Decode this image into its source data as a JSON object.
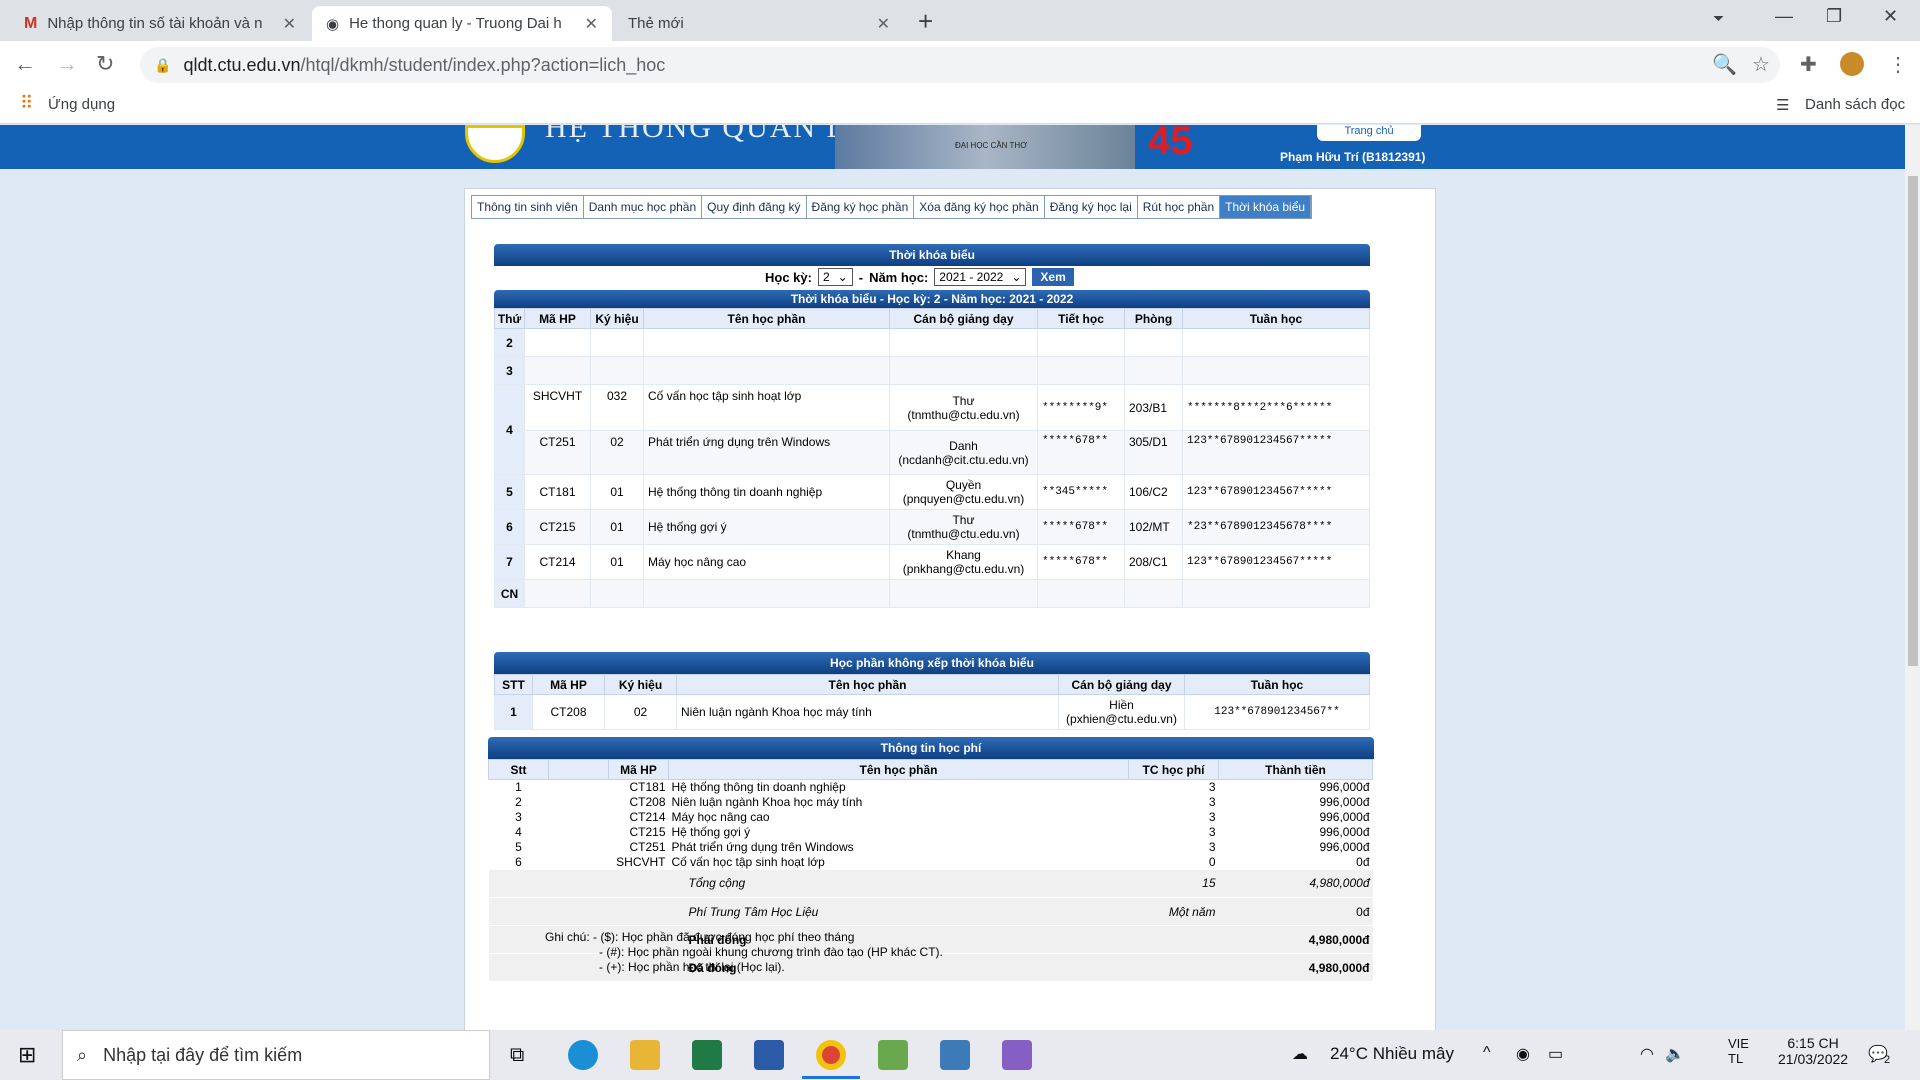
{
  "browser": {
    "tabs": [
      {
        "title": "Nhập thông tin số tài khoản và n",
        "icon": "gmail-icon"
      },
      {
        "title": "He thong quan ly - Truong Dai h",
        "icon": "globe-icon"
      },
      {
        "title": "Thẻ mới",
        "icon": ""
      }
    ],
    "url_host": "qldt.ctu.edu.vn",
    "url_path": "/htql/dkmh/student/index.php?action=lich_hoc",
    "bookmarks": {
      "apps": "Ứng dụng",
      "reading": "Danh sách đọc"
    }
  },
  "site": {
    "title": "HỆ THỐNG QUẢN LÝ",
    "home": "Trang chủ",
    "user": "Phạm Hữu Trí (B1812391)",
    "photo_caption": "ĐẠI HỌC CẦN THƠ",
    "menu": [
      "Thông tin sinh viên",
      "Danh mục học phần",
      "Quy định đăng ký",
      "Đăng ký học phần",
      "Xóa đăng ký học phần",
      "Đăng ký học lại",
      "Rút học phần",
      "Thời khóa biểu"
    ]
  },
  "schedule": {
    "header": "Thời khóa biểu",
    "hk_label": "Học kỳ:",
    "hk_value": "2",
    "nh_label": "Năm học:",
    "nh_value": "2021 - 2022",
    "button": "Xem",
    "subheader": "Thời khóa biểu - Học kỳ: 2 - Năm học: 2021 - 2022",
    "columns": [
      "Thứ",
      "Mã HP",
      "Ký hiệu",
      "Tên học phần",
      "Cán bộ giảng dạy",
      "Tiết học",
      "Phòng",
      "Tuần học"
    ],
    "days": [
      "2",
      "3",
      "4",
      "5",
      "6",
      "7",
      "CN"
    ],
    "rows": [
      {
        "ma": "SHCVHT",
        "kh": "032",
        "ten": "Cố vấn học tập sinh hoạt lớp",
        "gv": "Thư",
        "email": "(tnmthu@ctu.edu.vn)",
        "tiet": "********9*",
        "phong": "203/B1",
        "tuan": "*******8***2***6******"
      },
      {
        "ma": "CT251",
        "kh": "02",
        "ten": "Phát triển ứng dụng trên Windows",
        "gv": "Danh",
        "email": "(ncdanh@cit.ctu.edu.vn)",
        "tiet": "*****678**",
        "phong": "305/D1",
        "tuan": "123**678901234567*****"
      },
      {
        "ma": "CT181",
        "kh": "01",
        "ten": "Hệ thống thông tin doanh nghiệp",
        "gv": "Quyền",
        "email": "(pnquyen@ctu.edu.vn)",
        "tiet": "**345*****",
        "phong": "106/C2",
        "tuan": "123**678901234567*****"
      },
      {
        "ma": "CT215",
        "kh": "01",
        "ten": "Hệ thống gợi ý",
        "gv": "Thư",
        "email": "(tnmthu@ctu.edu.vn)",
        "tiet": "*****678**",
        "phong": "102/MT",
        "tuan": "*23**6789012345678****"
      },
      {
        "ma": "CT214",
        "kh": "01",
        "ten": "Máy học nâng cao",
        "gv": "Khang",
        "email": "(pnkhang@ctu.edu.vn)",
        "tiet": "*****678**",
        "phong": "208/C1",
        "tuan": "123**678901234567*****"
      }
    ]
  },
  "unscheduled": {
    "header": "Học phần không xếp thời khóa biểu",
    "columns": [
      "STT",
      "Mã HP",
      "Ký hiệu",
      "Tên học phần",
      "Cán bộ giảng dạy",
      "Tuần học"
    ],
    "row": {
      "stt": "1",
      "ma": "CT208",
      "kh": "02",
      "ten": "Niên luận ngành Khoa học máy tính",
      "gv": "Hiền",
      "email": "(pxhien@ctu.edu.vn)",
      "tuan": "123**678901234567**"
    }
  },
  "fees": {
    "header": "Thông tin học phí",
    "columns": [
      "Stt",
      "Mã HP",
      "Tên học phần",
      "TC học phí",
      "Thành tiền"
    ],
    "rows": [
      [
        "1",
        "CT181",
        "Hệ thống thông tin doanh nghiệp",
        "3",
        "996,000đ"
      ],
      [
        "2",
        "CT208",
        "Niên luận ngành Khoa học máy tính",
        "3",
        "996,000đ"
      ],
      [
        "3",
        "CT214",
        "Máy học nâng cao",
        "3",
        "996,000đ"
      ],
      [
        "4",
        "CT215",
        "Hệ thống gợi ý",
        "3",
        "996,000đ"
      ],
      [
        "5",
        "CT251",
        "Phát triển ứng dụng trên Windows",
        "3",
        "996,000đ"
      ],
      [
        "6",
        "SHCVHT",
        "Cố vấn học tập sinh hoạt lớp",
        "0",
        "0đ"
      ]
    ],
    "total_label": "Tổng cộng",
    "total_tc": "15",
    "total": "4,980,000đ",
    "center_label": "Phí Trung Tâm Học Liệu",
    "center_period": "Một năm",
    "center_fee": "0đ",
    "due_label": "Phải đóng",
    "due": "4,980,000đ",
    "paid_label": "Đã đóng",
    "paid": "4,980,000đ",
    "note_title": "Ghi chú:",
    "notes": [
      "- ($): Học phần đã được đóng học phí theo tháng",
      "- (#): Học phần ngoài khung chương trình đào tạo (HP khác CT).",
      "- (+): Học phần học thi lại (Học lại)."
    ]
  },
  "taskbar": {
    "search": "Nhập tại đây để tìm kiếm",
    "weather": "24°C  Nhiều mây",
    "lang1": "VIE",
    "lang2": "TL",
    "time": "6:15 CH",
    "date": "21/03/2022",
    "notif": "2"
  }
}
